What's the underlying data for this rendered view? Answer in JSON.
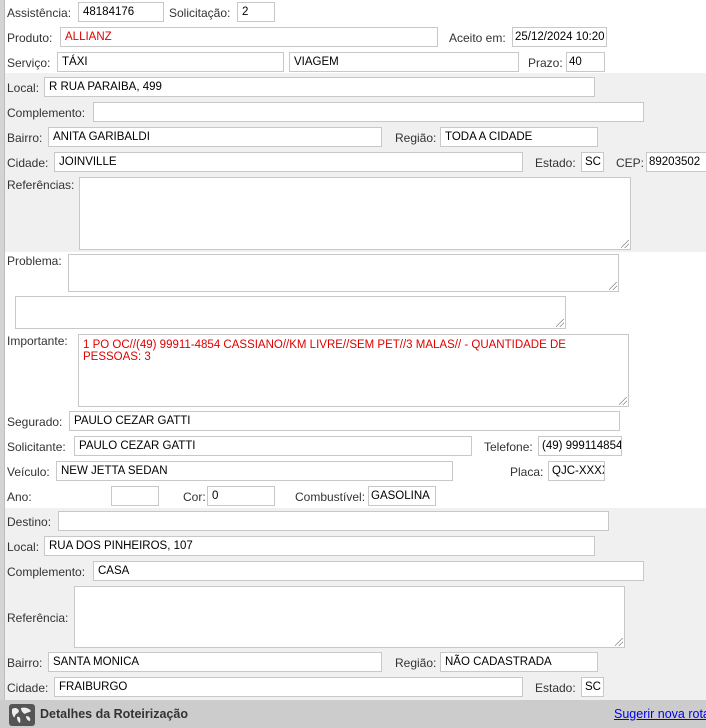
{
  "header": {
    "assistencia_label": "Assistência:",
    "assistencia": "48184176",
    "solicitacao_label": "Solicitação:",
    "solicitacao": "2",
    "produto_label": "Produto:",
    "produto": "ALLIANZ",
    "aceito_label": "Aceito em:",
    "aceito": "25/12/2024 10:20",
    "servico_label": "Serviço:",
    "servico": "TÁXI",
    "servico_tipo": "VIAGEM",
    "prazo_label": "Prazo:",
    "prazo": "40"
  },
  "origem": {
    "local_label": "Local:",
    "local": "R RUA PARAIBA, 499",
    "complemento_label": "Complemento:",
    "complemento": "",
    "bairro_label": "Bairro:",
    "bairro": "ANITA GARIBALDI",
    "regiao_label": "Região:",
    "regiao": "TODA A CIDADE",
    "cidade_label": "Cidade:",
    "cidade": "JOINVILLE",
    "estado_label": "Estado:",
    "estado": "SC",
    "cep_label": "CEP:",
    "cep": "89203502",
    "referencias_label": "Referências:",
    "referencias": ""
  },
  "detalhes": {
    "problema_label": "Problema:",
    "problema": "",
    "problema_extra": "",
    "importante_label": "Importante:",
    "importante": "1 PO OC//(49) 99911-4854 CASSIANO//KM LIVRE//SEM PET//3 MALAS// - QUANTIDADE DE PESSOAS: 3",
    "segurado_label": "Segurado:",
    "segurado": "PAULO CEZAR GATTI",
    "solicitante_label": "Solicitante:",
    "solicitante": "PAULO CEZAR GATTI",
    "telefone_label": "Telefone:",
    "telefone": "(49) 999114854",
    "veiculo_label": "Veículo:",
    "veiculo": "NEW JETTA SEDAN",
    "placa_label": "Placa:",
    "placa": "QJC-XXXX",
    "ano_label": "Ano:",
    "ano": "",
    "cor_label": "Cor:",
    "cor": "0",
    "combustivel_label": "Combustível:",
    "combustivel": "GASOLINA"
  },
  "destino": {
    "destino_label": "Destino:",
    "destino": "",
    "local_label": "Local:",
    "local": "RUA DOS PINHEIROS, 107",
    "complemento_label": "Complemento:",
    "complemento": "CASA",
    "referencia_label": "Referência:",
    "referencia": "",
    "bairro_label": "Bairro:",
    "bairro": "SANTA MONICA",
    "regiao_label": "Região:",
    "regiao": "NÃO CADASTRADA",
    "cidade_label": "Cidade:",
    "cidade": "FRAIBURGO",
    "estado_label": "Estado:",
    "estado": "SC"
  },
  "footer": {
    "title": "Detalhes da Roteirização",
    "link": "Sugerir nova rota",
    "icon": "globe-icon"
  },
  "colors": {
    "highlight": "#e00000",
    "link": "#0000ee",
    "section_bg": "#f0f0f0",
    "footer_bg": "#cccccc"
  }
}
